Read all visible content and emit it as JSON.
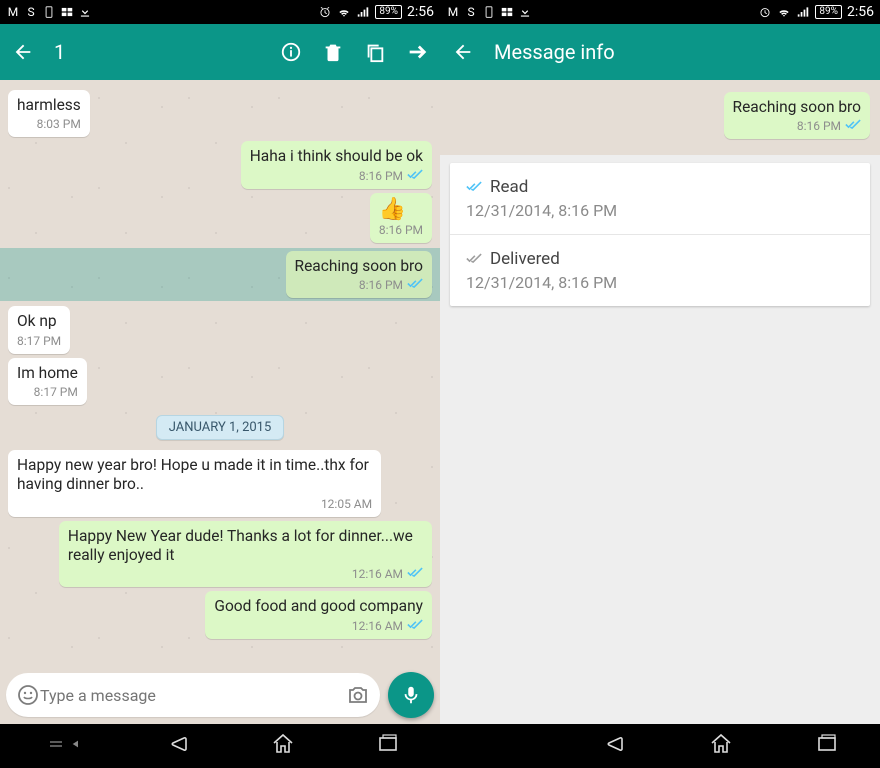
{
  "status": {
    "battery": "89%",
    "time": "2:56"
  },
  "left": {
    "toolbar_title": "1",
    "messages": [
      {
        "dir": "in",
        "text": "harmless",
        "time": "8:03 PM"
      },
      {
        "dir": "out",
        "text": "Haha i think should be ok",
        "time": "8:16 PM",
        "ticks": "blue"
      },
      {
        "dir": "out",
        "thumb": true,
        "time": "8:16 PM"
      },
      {
        "dir": "out",
        "text": "Reaching soon bro",
        "time": "8:16 PM",
        "ticks": "blue",
        "selected": true
      },
      {
        "dir": "in",
        "text": "Ok np",
        "time": "8:17 PM"
      },
      {
        "dir": "in",
        "text": "Im home",
        "time": "8:17 PM"
      },
      {
        "date": "JANUARY 1, 2015"
      },
      {
        "dir": "in",
        "text": "Happy new year bro! Hope u made it in time..thx for having dinner bro..",
        "time": "12:05 AM"
      },
      {
        "dir": "out",
        "text": "Happy New Year dude! Thanks a lot for dinner...we really enjoyed it",
        "time": "12:16 AM",
        "ticks": "blue"
      },
      {
        "dir": "out",
        "text": "Good food and good company",
        "time": "12:16 AM",
        "ticks": "blue"
      }
    ],
    "composer_placeholder": "Type a message"
  },
  "right": {
    "title": "Message info",
    "preview": {
      "text": "Reaching soon bro",
      "time": "8:16 PM"
    },
    "read": {
      "label": "Read",
      "time": "12/31/2014, 8:16 PM"
    },
    "delivered": {
      "label": "Delivered",
      "time": "12/31/2014, 8:16 PM"
    }
  }
}
